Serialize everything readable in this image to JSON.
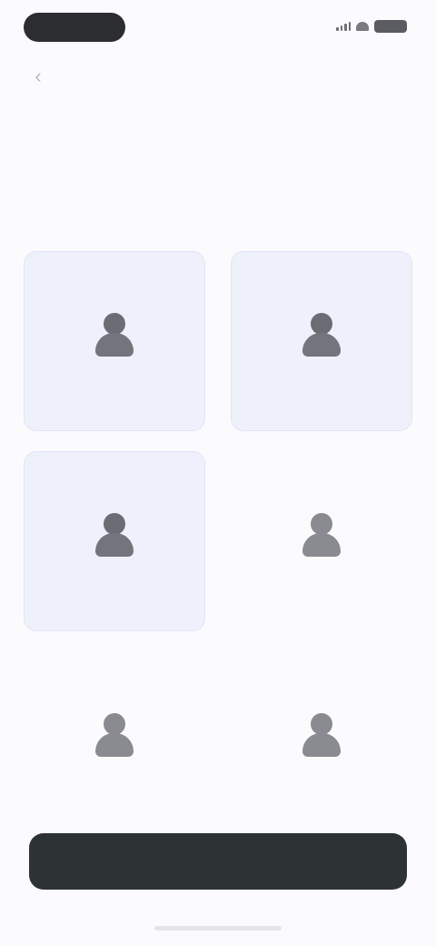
{
  "status_bar": {
    "time": "",
    "icons": [
      "signal-icon",
      "wifi-icon",
      "battery-icon"
    ]
  },
  "nav": {
    "back_icon": "chevron-left-icon",
    "title": "",
    "skip_label": ""
  },
  "step_label": "",
  "headline": "",
  "subtitle": "",
  "options": [
    {
      "label": "",
      "selected": true,
      "icon": "person-icon"
    },
    {
      "label": "",
      "selected": true,
      "icon": "person-icon"
    },
    {
      "label": "",
      "selected": true,
      "icon": "person-icon"
    },
    {
      "label": "",
      "selected": false,
      "icon": "person-icon"
    },
    {
      "label": "",
      "selected": false,
      "icon": "person-icon"
    },
    {
      "label": "",
      "selected": false,
      "icon": "person-icon"
    }
  ],
  "cta_label": "",
  "colors": {
    "accent_selected_bg": "#eef0fb",
    "step_label": "#f0c7a1",
    "cta_bg": "#2d3235"
  }
}
